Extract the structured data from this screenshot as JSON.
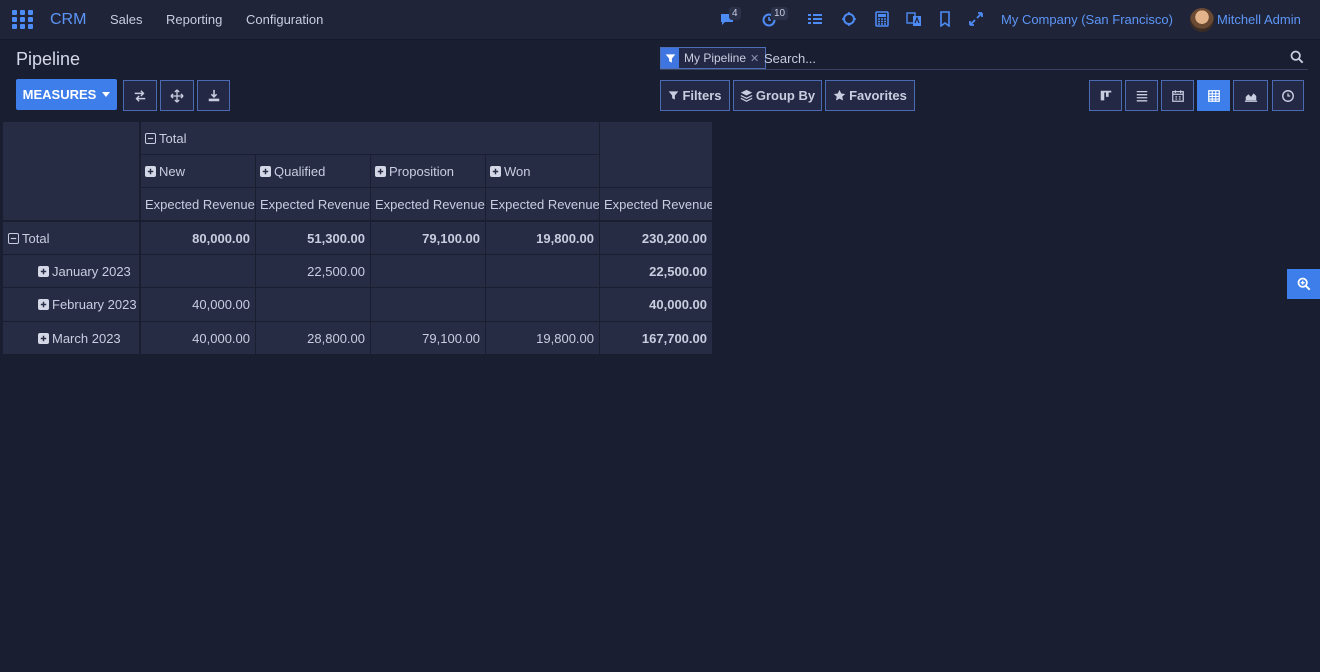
{
  "navbar": {
    "brand": "CRM",
    "menu": [
      "Sales",
      "Reporting",
      "Configuration"
    ],
    "messages_count": "4",
    "activities_count": "10",
    "company": "My Company (San Francisco)",
    "user": "Mitchell Admin",
    "icons": [
      "apps-grid-icon",
      "chat-icon",
      "clock-icon",
      "list-settings-icon",
      "bug-icon",
      "calculator-icon",
      "translate-icon",
      "bookmark-icon",
      "expand-icon"
    ]
  },
  "control": {
    "title": "Pipeline",
    "measures_label": "MEASURES",
    "facet_label": "My Pipeline",
    "search_placeholder": "Search...",
    "filters_label": "Filters",
    "groupby_label": "Group By",
    "favorites_label": "Favorites",
    "views": [
      "kanban",
      "list",
      "calendar",
      "pivot",
      "graph",
      "activity"
    ],
    "active_view": "pivot"
  },
  "pivot": {
    "col_group_header": "Total",
    "stages": [
      "New",
      "Qualified",
      "Proposition",
      "Won"
    ],
    "measure": "Expected Revenue",
    "total_label": "Total",
    "rows": [
      {
        "label": "Total",
        "values": [
          "80,000.00",
          "51,300.00",
          "79,100.00",
          "19,800.00"
        ],
        "total": "230,200.00"
      },
      {
        "label": "January 2023",
        "values": [
          "",
          "22,500.00",
          "",
          ""
        ],
        "total": "22,500.00"
      },
      {
        "label": "February 2023",
        "values": [
          "40,000.00",
          "",
          "",
          ""
        ],
        "total": "40,000.00"
      },
      {
        "label": "March 2023",
        "values": [
          "40,000.00",
          "28,800.00",
          "79,100.00",
          "19,800.00"
        ],
        "total": "167,700.00"
      }
    ]
  },
  "colors": {
    "background": "#1a1e31",
    "navbar": "#1f2438",
    "accent": "#3d7eea",
    "cell": "#272c45"
  }
}
